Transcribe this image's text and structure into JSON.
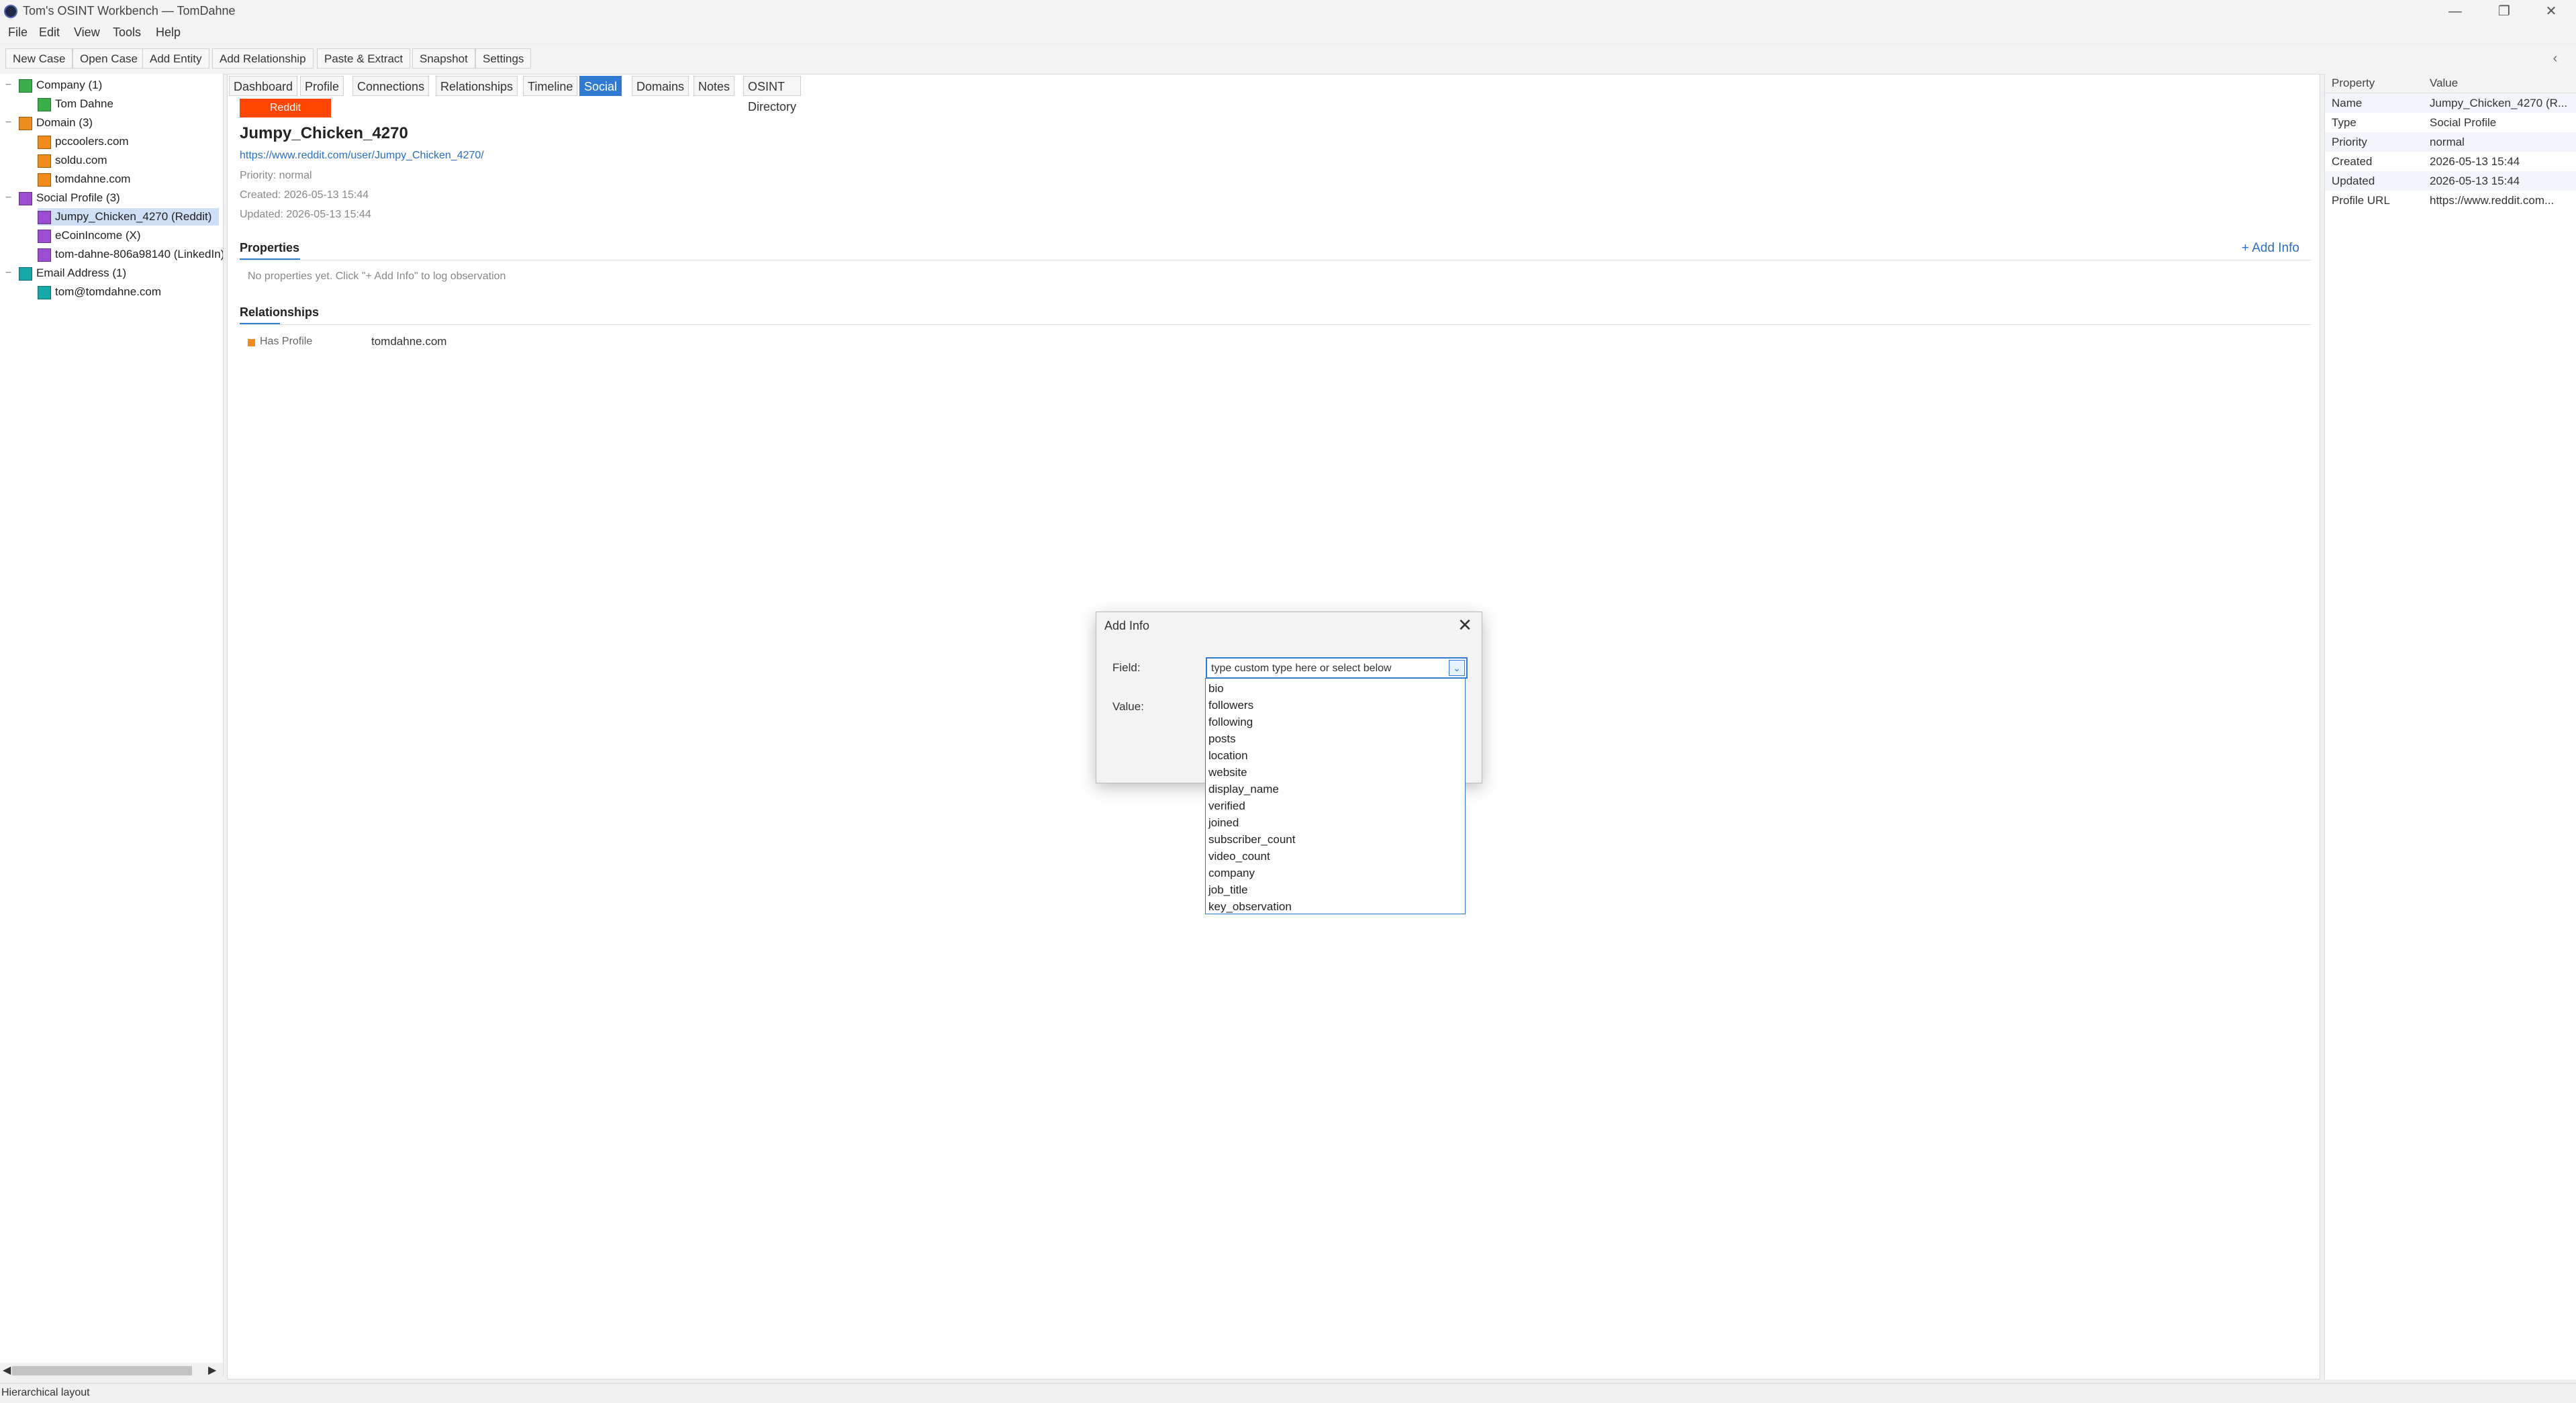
{
  "window": {
    "title": "Tom's OSINT Workbench — TomDahne",
    "controls": [
      "—",
      "❐",
      "✕"
    ]
  },
  "menu": [
    "File",
    "Edit",
    "View",
    "Tools",
    "Help"
  ],
  "toolbar": {
    "buttons": [
      "New Case",
      "Open Case",
      "Add Entity",
      "Add Relationship",
      "Paste & Extract",
      "Snapshot",
      "Settings"
    ],
    "collapse": "‹"
  },
  "tree": {
    "groups": [
      {
        "label": "Company (1)",
        "color": "#3aae4a",
        "children": [
          {
            "label": "Tom Dahne",
            "color": "#3aae4a"
          }
        ]
      },
      {
        "label": "Domain (3)",
        "color": "#f08c1e",
        "children": [
          {
            "label": "pccoolers.com",
            "color": "#f08c1e"
          },
          {
            "label": "soldu.com",
            "color": "#f08c1e"
          },
          {
            "label": "tomdahne.com",
            "color": "#f08c1e"
          }
        ]
      },
      {
        "label": "Social Profile (3)",
        "color": "#9b4fd0",
        "children": [
          {
            "label": "Jumpy_Chicken_4270 (Reddit)",
            "color": "#9b4fd0",
            "selected": true
          },
          {
            "label": "eCoinIncome (X)",
            "color": "#9b4fd0"
          },
          {
            "label": "tom-dahne-806a98140 (LinkedIn)",
            "color": "#9b4fd0"
          }
        ]
      },
      {
        "label": "Email Address (1)",
        "color": "#17a8a8",
        "children": [
          {
            "label": "tom@tomdahne.com",
            "color": "#17a8a8"
          }
        ]
      }
    ],
    "toggle_symbol": "−",
    "scroll_left": "◀",
    "scroll_right": "▶"
  },
  "tabs": [
    "Dashboard",
    "Profile",
    "Connections",
    "Relationships",
    "Timeline",
    "Social",
    "Domains",
    "Notes",
    "OSINT Directory"
  ],
  "active_tab": "Social",
  "entity": {
    "platform": "Reddit",
    "platform_color": "#ff4500",
    "name": "Jumpy_Chicken_4270",
    "url": "https://www.reddit.com/user/Jumpy_Chicken_4270/",
    "priority": "Priority: normal",
    "created": "Created: 2026-05-13 15:44",
    "updated": "Updated: 2026-05-13 15:44"
  },
  "properties_section": {
    "title": "Properties",
    "add_info": "+ Add Info",
    "empty": "No properties yet. Click \"+ Add Info\" to log observation"
  },
  "relationships_section": {
    "title": "Relationships",
    "items": [
      {
        "type": "Has Profile",
        "target": "tomdahne.com"
      }
    ]
  },
  "props_panel": {
    "headers": [
      "Property",
      "Value"
    ],
    "rows": [
      {
        "k": "Name",
        "v": "Jumpy_Chicken_4270 (R..."
      },
      {
        "k": "Type",
        "v": "Social Profile"
      },
      {
        "k": "Priority",
        "v": "normal"
      },
      {
        "k": "Created",
        "v": "2026-05-13 15:44"
      },
      {
        "k": "Updated",
        "v": "2026-05-13 15:44"
      },
      {
        "k": "Profile URL",
        "v": "https://www.reddit.com..."
      }
    ]
  },
  "status": "Hierarchical layout",
  "dialog": {
    "title": "Add Info",
    "close": "✕",
    "field_label": "Field:",
    "value_label": "Value:",
    "field_value": "type custom type here or select below",
    "arrow": "⌄",
    "options": [
      "bio",
      "followers",
      "following",
      "posts",
      "location",
      "website",
      "display_name",
      "verified",
      "joined",
      "subscriber_count",
      "video_count",
      "company",
      "job_title",
      "key_observation"
    ]
  }
}
